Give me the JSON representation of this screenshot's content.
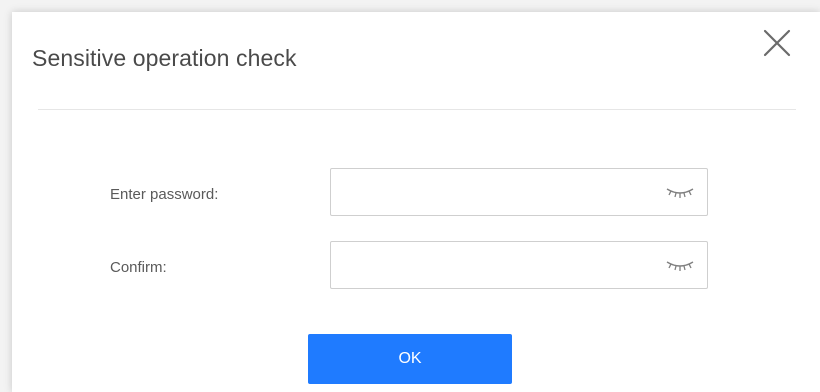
{
  "dialog": {
    "title": "Sensitive operation check"
  },
  "form": {
    "password_label": "Enter password:",
    "password_value": "",
    "confirm_label": "Confirm:",
    "confirm_value": ""
  },
  "actions": {
    "ok_label": "OK"
  },
  "icons": {
    "close": "close-icon",
    "toggle_visibility": "eye-closed-icon"
  },
  "colors": {
    "primary_button": "#1f7bff",
    "title_text": "#4a4a4a",
    "border": "#cfcfcf"
  }
}
